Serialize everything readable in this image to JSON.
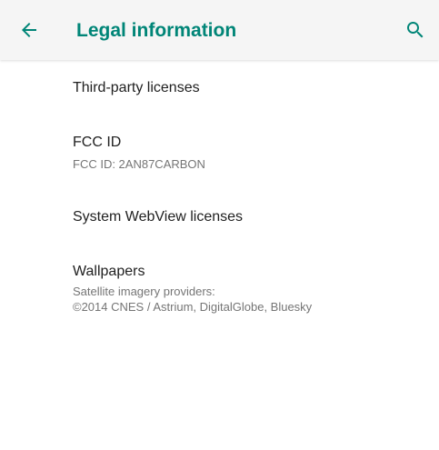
{
  "app_bar": {
    "title": "Legal information",
    "back_icon": "arrow-back-icon",
    "search_icon": "search-icon",
    "accent_color": "#008577"
  },
  "preferences": [
    {
      "title": "Third-party licenses"
    },
    {
      "title": "FCC ID",
      "summary": "FCC ID: 2AN87CARBON"
    },
    {
      "title": "System WebView licenses"
    },
    {
      "title": "Wallpapers",
      "summary_lines": [
        "Satellite imagery providers:",
        "©2014 CNES / Astrium, DigitalGlobe, Bluesky"
      ]
    }
  ]
}
